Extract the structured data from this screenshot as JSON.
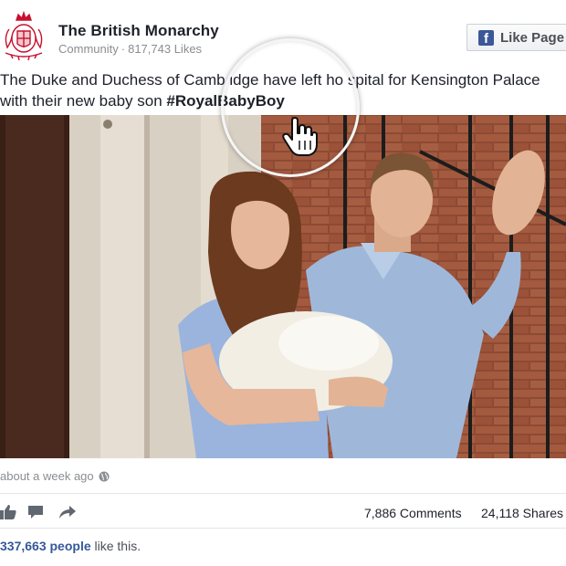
{
  "page": {
    "name": "The British Monarchy",
    "category": "Community",
    "likes_count": "817,743 Likes",
    "like_button_label": "Like Page"
  },
  "post": {
    "message_part1": "The Duke and Duchess of Camb",
    "message_part2": "idge have left ho",
    "message_part3": "spital for Kensington Palace with their new baby son ",
    "hashtag": "#RoyalBabyBoy",
    "timestamp": "about a week ago"
  },
  "stats": {
    "comments": "7,886 Comments",
    "shares": "24,118 Shares",
    "likes_count": "337,663 people",
    "likes_suffix": " like this."
  },
  "icons": {
    "crest": "royal-crest-icon",
    "facebook": "facebook-icon",
    "globe": "globe-icon",
    "like": "thumbs-up-icon",
    "comment": "comment-icon",
    "share": "share-arrow-icon",
    "cursor": "hand-cursor-icon"
  },
  "colors": {
    "facebook_blue": "#3b5998",
    "link_blue": "#365899",
    "muted_text": "#8a8d91",
    "crest_red": "#c8102e"
  }
}
